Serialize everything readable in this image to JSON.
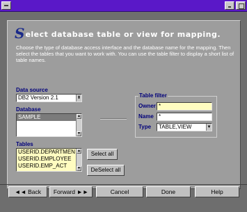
{
  "window": {
    "menu_icon": "system-menu-icon",
    "minimize_icon": "minimize-icon",
    "maximize_icon": "maximize-icon"
  },
  "heading": {
    "initial": "S",
    "text": "elect database table or view for mapping."
  },
  "description": "Choose the type of database access interface and the database name for the mapping. Then select the tables that you want to work with. You can use the table filter to display a short list of table names.",
  "data_source": {
    "label": "Data source",
    "value": "DB2 Version 2.1"
  },
  "database": {
    "label": "Database",
    "items": [
      "SAMPLE"
    ]
  },
  "tables": {
    "label": "Tables",
    "items": [
      "USERID.DEPARTMEN",
      "USERID.EMPLOYEE",
      "USERID.EMP_ACT"
    ]
  },
  "buttons": {
    "select_all": "Select all",
    "deselect_all": "DeSelect all"
  },
  "table_filter": {
    "title": "Table filter",
    "owner_label": "Owner",
    "owner_value": "*",
    "name_label": "Name",
    "name_value": "*",
    "type_label": "Type",
    "type_value": "TABLE,VIEW"
  },
  "nav": {
    "back": "◄◄ Back",
    "forward": "Forward ►►",
    "cancel": "Cancel",
    "done": "Done",
    "help": "Help"
  },
  "colors": {
    "title_bar": "#5a18c8",
    "panel": "#9d9d9d",
    "label_blue": "#00007a",
    "input_yellow": "#fffcc0"
  }
}
